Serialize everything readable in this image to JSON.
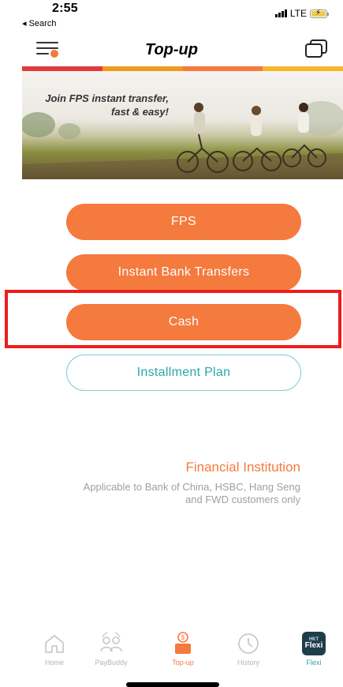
{
  "status_bar": {
    "time": "2:55",
    "back_label": "◂ Search",
    "network": "LTE"
  },
  "nav": {
    "title": "Top-up",
    "menu_icon": "menu-icon",
    "cards_icon": "cards-icon"
  },
  "color_strip": [
    "#e23a3a",
    "#f39a1c",
    "#f47a3e",
    "#f7b52c"
  ],
  "banner": {
    "line1": "Join FPS instant transfer,",
    "line2": "fast & easy!"
  },
  "buttons": {
    "fps": "FPS",
    "instant_bank": "Instant Bank Transfers",
    "cash": "Cash",
    "installment": "Installment Plan"
  },
  "financial_institution": {
    "title": "Financial Institution",
    "description": "Applicable to Bank of China, HSBC, Hang Seng and FWD customers only"
  },
  "tabbar": {
    "items": [
      {
        "label": "Home",
        "icon": "home-icon"
      },
      {
        "label": "PayBuddy",
        "icon": "paybuddy-icon"
      },
      {
        "label": "Top-up",
        "icon": "topup-icon"
      },
      {
        "label": "History",
        "icon": "history-icon"
      },
      {
        "label": "Flexi",
        "icon": "flexi-logo"
      }
    ],
    "flexi_logo_small": "HKT",
    "flexi_logo_big": "Flexi"
  },
  "colors": {
    "accent": "#f47a3e",
    "teal": "#2aa6a8",
    "highlight": "#ee1c1c"
  }
}
